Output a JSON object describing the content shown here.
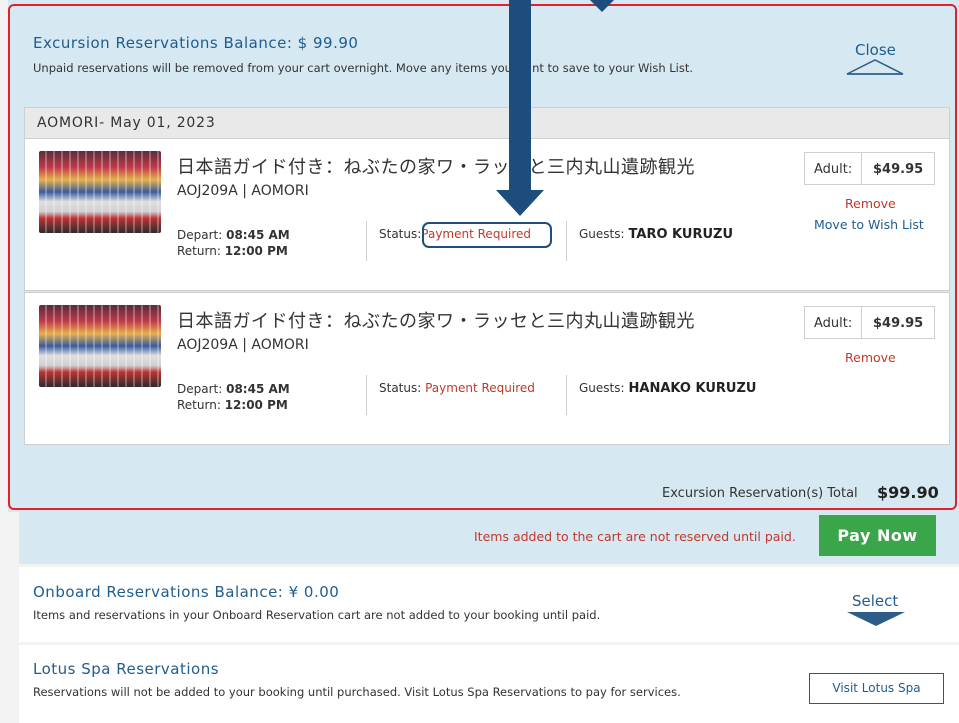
{
  "excursion": {
    "title": "Excursion Reservations Balance: $ 99.90",
    "subtitle": "Unpaid reservations will be removed from your cart overnight. Move any items you want to save to your Wish List.",
    "close_label": "Close",
    "port_date": "AOMORI- May 01, 2023",
    "items": [
      {
        "title": "日本語ガイド付き：ねぶたの家ワ・ラッセと三内丸山遺跡観光",
        "code": "AOJ209A | AOMORI",
        "depart_label": "Depart:",
        "depart_time": "08:45 AM",
        "return_label": "Return:",
        "return_time": "12:00 PM",
        "status_label": "Status:",
        "status_value": "Payment Required",
        "guests_label": "Guests:",
        "guests_value": "TARO KURUZU",
        "price_label": "Adult:",
        "price_value": "$49.95",
        "remove_label": "Remove",
        "wish_label": "Move to Wish List"
      },
      {
        "title": "日本語ガイド付き：ねぶたの家ワ・ラッセと三内丸山遺跡観光",
        "code": "AOJ209A | AOMORI",
        "depart_label": "Depart:",
        "depart_time": "08:45 AM",
        "return_label": "Return:",
        "return_time": "12:00 PM",
        "status_label": "Status:",
        "status_value": "Payment Required",
        "guests_label": "Guests:",
        "guests_value": "HANAKO KURUZU",
        "price_label": "Adult:",
        "price_value": "$49.95",
        "remove_label": "Remove"
      }
    ],
    "total_label": "Excursion Reservation(s) Total",
    "total_value": "$99.90"
  },
  "payment": {
    "note": "Items added to the cart are not reserved until paid.",
    "button": "Pay Now"
  },
  "onboard": {
    "title": "Onboard Reservations Balance: ¥ 0.00",
    "subtitle": "Items and reservations in your Onboard Reservation cart are not added to your booking until paid.",
    "select_label": "Select"
  },
  "spa": {
    "title": "Lotus Spa Reservations",
    "subtitle": "Reservations will not be added to your booking until purchased. Visit Lotus Spa Reservations to pay for services.",
    "button": "Visit Lotus Spa"
  },
  "colors": {
    "accent": "#1f5c8f",
    "alert": "#c0392b",
    "pay": "#3aa64a",
    "highlight": "#e2202b",
    "arrow": "#1c4d7c"
  }
}
